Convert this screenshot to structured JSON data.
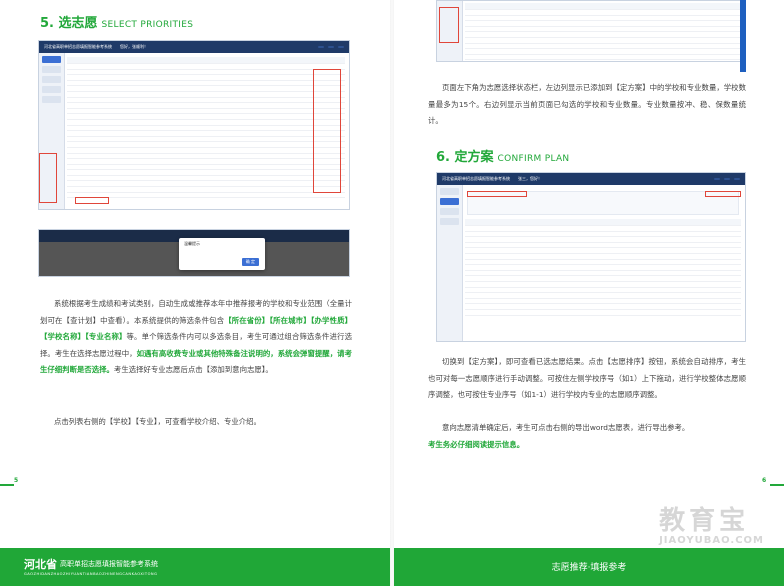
{
  "left_page": {
    "section_number": "5. 选志愿",
    "section_en": "SELECT PRIORITIES",
    "screenshot1_title": "河北省高职单招志愿填报智能参考系统",
    "screenshot1_user": "您好，张顺利！",
    "modal_title": "温馨提示",
    "modal_button": "确 定",
    "para1_a": "系统根据考生成绩和考试类别，自动生成或推荐本年中推荐报考的学校和专业范围（全量计划可在【查计划】中查看）。本系统提供的筛选条件包含",
    "para1_hl": "【所在省份】【所在城市】【办学性质】【学校名称】【专业名称】",
    "para1_b": "等。单个筛选条件内可以多选条目，考生可通过组合筛选条件进行选择。考生在选择志愿过程中，",
    "para1_hl2": "如遇有高收费专业或其他特殊备注说明的，系统会弹窗提醒，请考生仔细判断是否选择。",
    "para1_c": "考生选择好专业志愿后点击【添加到意向志愿】。",
    "para2": "点击列表右侧的【学校】【专业】，可查看学校介绍、专业介绍。",
    "page_number": "5",
    "footer_title": "河北省",
    "footer_subtitle": "高职单招志愿填报智能参考系统",
    "footer_pinyin": "GAOZHIDANZHAOZHIYUANTIANBAOZHINENGCANKAOXITONG"
  },
  "right_page": {
    "para_top": "页面左下角为志愿选择状态栏，左边列显示已添加到【定方案】中的学校和专业数量，学校数量最多为15个。右边列显示当前页面已勾选的学校和专业数量。专业数量按冲、稳、保数量统计。",
    "section_number": "6. 定方案",
    "section_en": "CONFIRM PLAN",
    "screenshot3_title": "河北省高职单招志愿填报智能参考系统",
    "screenshot3_user": "张三，您好！",
    "para2": "切换到【定方案】，即可查看已选志愿结果。点击【志愿排序】按钮，系统会自动排序，考生也可对每一志愿顺序进行手动调整。可按住左侧学校序号（如1）上下拖动，进行学校整体志愿顺序调整，也可按住专业序号（如1-1）进行学校内专业的志愿顺序调整。",
    "para3": "意向志愿清单确定后，考生可点击右侧的导出word志愿表，进行导出参考。",
    "para4_hl": "考生务必仔细阅读提示信息。",
    "page_number": "6",
    "footer_title": "志愿推荐·填报参考",
    "watermark_cn": "教育宝",
    "watermark_en": "JIAOYUBAO.COM"
  },
  "colors": {
    "accent_green": "#22a83a",
    "nav_blue": "#1f3a68",
    "corner_blue": "#1e5fbf",
    "highlight_red": "#e0463a"
  }
}
